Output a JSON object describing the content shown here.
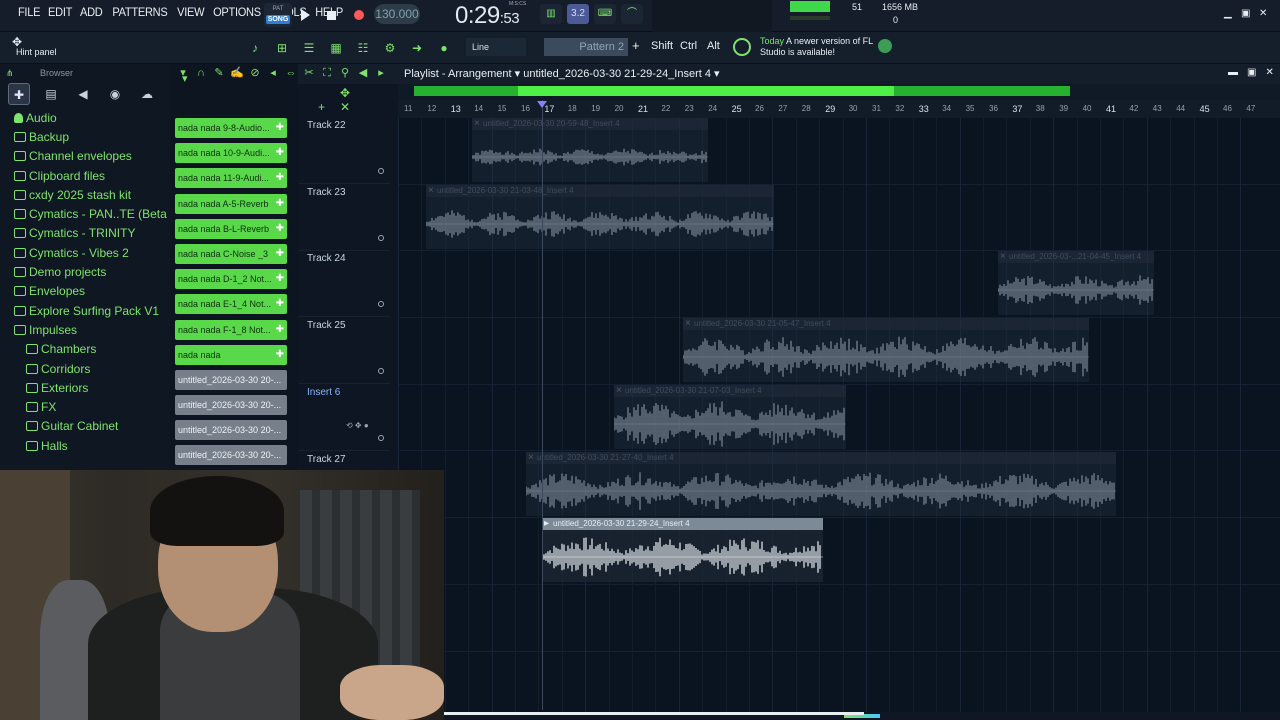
{
  "menu": [
    "FILE",
    "EDIT",
    "ADD",
    "PATTERNS",
    "VIEW",
    "OPTIONS",
    "TOOLS",
    "HELP"
  ],
  "transport": {
    "pat_label": "PAT",
    "song_label": "SONG",
    "tempo": "130.000",
    "time_main": "0:29",
    "time_sub": ":53",
    "time_unit": "M:S:CS",
    "snap_value": "3.2"
  },
  "status": {
    "cpu_value": "51",
    "memory": "1656 MB",
    "polyphony": "0"
  },
  "toolbar2": {
    "hint_title": "Hint panel",
    "snap_mode": "Line",
    "pattern": "Pattern 2",
    "keys": [
      "Shift",
      "Ctrl",
      "Alt"
    ],
    "news_today": "Today",
    "news_text": "A newer version of FL Studio is available!"
  },
  "browser": {
    "title": "Browser",
    "items": [
      {
        "label": "Audio",
        "level": 1,
        "kind": "audio"
      },
      {
        "label": "Backup",
        "level": 1,
        "kind": "folder"
      },
      {
        "label": "Channel envelopes",
        "level": 1,
        "kind": "folder"
      },
      {
        "label": "Clipboard files",
        "level": 1,
        "kind": "folder"
      },
      {
        "label": "cxdy 2025 stash kit",
        "level": 1,
        "kind": "folder"
      },
      {
        "label": "Cymatics - PAN..TE (Beta Pack)",
        "level": 1,
        "kind": "folder"
      },
      {
        "label": "Cymatics - TRINITY",
        "level": 1,
        "kind": "folder"
      },
      {
        "label": "Cymatics - Vibes 2",
        "level": 1,
        "kind": "folder"
      },
      {
        "label": "Demo projects",
        "level": 1,
        "kind": "folder"
      },
      {
        "label": "Envelopes",
        "level": 1,
        "kind": "folder"
      },
      {
        "label": "Explore Surfing Pack V1",
        "level": 1,
        "kind": "folder"
      },
      {
        "label": "Impulses",
        "level": 1,
        "kind": "folder"
      },
      {
        "label": "Chambers",
        "level": 2,
        "kind": "folder"
      },
      {
        "label": "Corridors",
        "level": 2,
        "kind": "folder"
      },
      {
        "label": "Exteriors",
        "level": 2,
        "kind": "folder"
      },
      {
        "label": "FX",
        "level": 2,
        "kind": "folder"
      },
      {
        "label": "Guitar Cabinet",
        "level": 2,
        "kind": "folder"
      },
      {
        "label": "Halls",
        "level": 2,
        "kind": "folder"
      }
    ]
  },
  "channels": [
    {
      "label": "nada nada 9-8-Audio...",
      "color": "green"
    },
    {
      "label": "nada nada 10-9-Audi...",
      "color": "green"
    },
    {
      "label": "nada nada 11-9-Audi...",
      "color": "green"
    },
    {
      "label": "nada nada A-5-Reverb",
      "color": "green"
    },
    {
      "label": "nada nada B-L-Reverb",
      "color": "green"
    },
    {
      "label": "nada nada C-Noise _3",
      "color": "green"
    },
    {
      "label": "nada nada D-1_2 Not...",
      "color": "green"
    },
    {
      "label": "nada nada E-1_4 Not...",
      "color": "green"
    },
    {
      "label": "nada nada F-1_8 Not...",
      "color": "green"
    },
    {
      "label": "nada nada",
      "color": "green"
    },
    {
      "label": "untitled_2026-03-30 20-...",
      "color": "gray"
    },
    {
      "label": "untitled_2026-03-30 20-...",
      "color": "gray"
    },
    {
      "label": "untitled_2026-03-30 20-...",
      "color": "gray"
    },
    {
      "label": "untitled_2026-03-30 20-...",
      "color": "gray"
    }
  ],
  "playlist": {
    "title_prefix": "Playlist - Arrangement",
    "title_file": "untitled_2026-03-30 21-29-24_Insert 4",
    "ruler": [
      "11",
      "12",
      "13",
      "14",
      "15",
      "16",
      "17",
      "18",
      "19",
      "20",
      "21",
      "22",
      "23",
      "24",
      "25",
      "26",
      "27",
      "28",
      "29",
      "30",
      "31",
      "32",
      "33",
      "34",
      "35",
      "36",
      "37",
      "38",
      "39",
      "40",
      "41",
      "42",
      "43",
      "44",
      "45",
      "46",
      "47"
    ],
    "tracks": [
      "Track 22",
      "Track 23",
      "Track 24",
      "Track 25",
      "Insert 6",
      "Track 27"
    ],
    "clips": [
      {
        "label": "untitled_2026-03-30 20-59-48_Insert 4",
        "row": 0,
        "active": false
      },
      {
        "label": "untitled_2026-03-30 21-03-48_Insert 4",
        "row": 1,
        "active": false
      },
      {
        "label": "untitled_2026-03-...21-04-45_Insert 4",
        "row": 2,
        "active": false
      },
      {
        "label": "untitled_2026-03-30 21-05-47_Insert 4",
        "row": 3,
        "active": false
      },
      {
        "label": "untitled_2026-03-30 21-07-03_Insert 4",
        "row": 4,
        "active": false
      },
      {
        "label": "untitled_2026-03-30 21-27-40_Insert 4",
        "row": 5,
        "active": false
      },
      {
        "label": "untitled_2026-03-30 21-29-24_Insert 4",
        "row": 6,
        "active": true
      }
    ]
  }
}
